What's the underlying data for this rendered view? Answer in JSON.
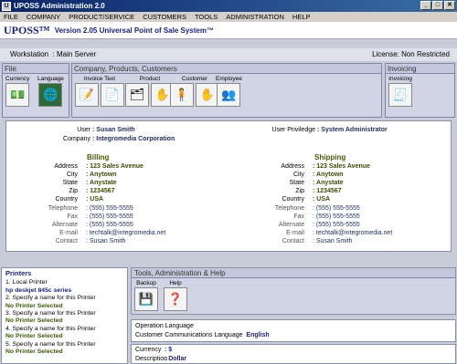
{
  "window": {
    "title": "UPOSS Administration 2.0",
    "controls": [
      "_",
      "□",
      "✕"
    ]
  },
  "menu": [
    "FILE",
    "COMPANY",
    "PRODUCT/SERVICE",
    "CUSTOMERS",
    "TOOLS",
    "ADMINISTRATION",
    "HELP"
  ],
  "banner": {
    "brand": "UPOSS™",
    "tagline": "Version 2.05  Universal Point of Sale System™"
  },
  "status": {
    "workstation_label": "Workstation",
    "workstation_value": ": Main Server",
    "license_label": "License: Non Restricted"
  },
  "groups": {
    "file": {
      "title": "File",
      "tools": [
        {
          "label": "Currency",
          "icon": "currency-icon"
        },
        {
          "label": "Language",
          "icon": "globe-icon"
        }
      ]
    },
    "company": {
      "title": "Company, Products, Customers",
      "tools": [
        {
          "label": "Invoice Text",
          "icon": "invoice-text-icon"
        },
        {
          "label": "Product",
          "icon": "product-icon"
        },
        {
          "label": "Customer",
          "icon": "customer-icon"
        },
        {
          "label": "Employee",
          "icon": "employee-icon"
        }
      ]
    },
    "invoicing": {
      "title": "Invoicing",
      "tools": [
        {
          "label": "Invoicing",
          "icon": "invoicing-icon"
        }
      ]
    },
    "tah": {
      "title": "Tools, Administration & Help",
      "tools": [
        {
          "label": "Backup",
          "icon": "backup-icon"
        },
        {
          "label": "Help",
          "icon": "help-icon"
        }
      ]
    }
  },
  "user_card": {
    "user_label": "User",
    "user_value": ": Susan Smith",
    "company_label": "Company",
    "company_value": ": Integromedia Corporation",
    "privilege_label": "User Priviledge",
    "privilege_value": ": System Administrator",
    "billing": {
      "heading": "Billing",
      "rows": [
        {
          "label": "Address",
          "value": ": 123 Sales Avenue"
        },
        {
          "label": "City",
          "value": ": Anytown"
        },
        {
          "label": "State",
          "value": ": Anystate"
        },
        {
          "label": "Zip",
          "value": ": 1234567"
        },
        {
          "label": "Country",
          "value": ": USA"
        }
      ],
      "contact_rows": [
        {
          "label": "Telephone",
          "value": ": (555) 555-5555"
        },
        {
          "label": "Fax",
          "value": ": (555) 555-5555"
        },
        {
          "label": "Alternate",
          "value": ": (555) 555-5555"
        },
        {
          "label": "E-mail",
          "value": ": techtalk@integromedia.net"
        },
        {
          "label": "Contact",
          "value": ": Susan Smith"
        }
      ]
    },
    "shipping": {
      "heading": "Shipping",
      "rows": [
        {
          "label": "Address",
          "value": ": 123 Sales Avenue"
        },
        {
          "label": "City",
          "value": ": Anytown"
        },
        {
          "label": "State",
          "value": ": Anystate"
        },
        {
          "label": "Zip",
          "value": ": 1234567"
        },
        {
          "label": "Country",
          "value": ": USA"
        }
      ],
      "contact_rows": [
        {
          "label": "Telephone",
          "value": ": (555) 555-5555"
        },
        {
          "label": "Fax",
          "value": ": (555) 555-5555"
        },
        {
          "label": "Alternate",
          "value": ": (555) 555-5555"
        },
        {
          "label": "E-mail",
          "value": ": techtalk@integromedia.net"
        },
        {
          "label": "Contact",
          "value": ": Susan Smith"
        }
      ]
    }
  },
  "printers": {
    "title": "Printers",
    "lines": [
      {
        "text": "1. Local Printer",
        "style": "normal"
      },
      {
        "text": "hp deskjet 845c series",
        "style": "b"
      },
      {
        "text": "2. Specify a name for this Printer",
        "style": "normal"
      },
      {
        "text": "No Printer Selected",
        "style": "g"
      },
      {
        "text": "3. Specify a name for this Printer",
        "style": "normal"
      },
      {
        "text": "No Printer Selected",
        "style": "g"
      },
      {
        "text": "4. Specify a name for this Printer",
        "style": "normal"
      },
      {
        "text": "No Printer Selected",
        "style": "g"
      },
      {
        "text": "5. Specify a name for this Printer",
        "style": "normal"
      },
      {
        "text": "No Printer Selected",
        "style": "g"
      }
    ]
  },
  "operation_language": {
    "title": "Operation Language",
    "label": "Customer Communications Language",
    "value": "English"
  },
  "currency": {
    "currency_label": "Currency",
    "currency_value": ": $",
    "description_label": "Description",
    "description_value": ": Dollar"
  }
}
